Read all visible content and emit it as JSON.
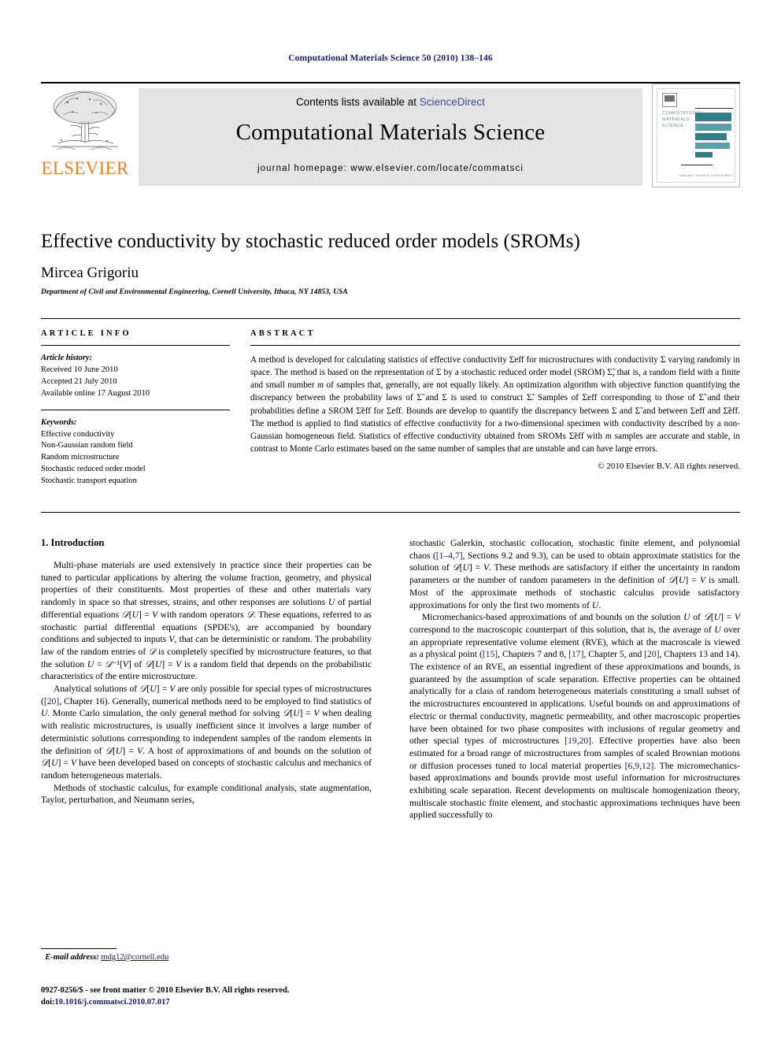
{
  "running_head": "Computational Materials Science 50 (2010) 138–146",
  "masthead": {
    "contents_prefix": "Contents lists available at ",
    "sciencedirect": "ScienceDirect",
    "journal_title": "Computational Materials Science",
    "homepage": "journal homepage: www.elsevier.com/locate/commatsci",
    "publisher": "ELSEVIER",
    "cover": {
      "line1": "COMPUTATIONAL",
      "line2": "MATERIALS",
      "line3": "SCIENCE",
      "footer": "AVAILABLE ONLINE AT SCIENCEDIRECT"
    },
    "link_color": "#3b4ba8",
    "brand_color": "#ef7d22",
    "banner_bg": "#e4e4e4"
  },
  "article": {
    "title": "Effective conductivity by stochastic reduced order models (SROMs)",
    "author": "Mircea Grigoriu",
    "affiliation": "Department of Civil and Environmental Engineering, Cornell University, Ithaca, NY 14853, USA"
  },
  "info": {
    "heading": "ARTICLE INFO",
    "history_label": "Article history:",
    "history": [
      "Received 10 June 2010",
      "Accepted 21 July 2010",
      "Available online 17 August 2010"
    ],
    "keywords_label": "Keywords:",
    "keywords": [
      "Effective conductivity",
      "Non-Gaussian random field",
      "Random microstructure",
      "Stochastic reduced order model",
      "Stochastic transport equation"
    ]
  },
  "abstract": {
    "heading": "ABSTRACT",
    "text": "A method is developed for calculating statistics of effective conductivity Σeff for microstructures with conductivity Σ varying randomly in space. The method is based on the representation of Σ by a stochastic reduced order model (SROM) Σ̃, that is, a random field with a finite and small number m of samples that, generally, are not equally likely. An optimization algorithm with objective function quantifying the discrepancy between the probability laws of Σ̃ and Σ is used to construct Σ̃. Samples of Σeff corresponding to those of Σ̃ and their probabilities define a SROM Σ̃eff for Σeff. Bounds are develop to quantify the discrepancy between Σ and Σ̃ and between Σeff and Σ̃eff. The method is applied to find statistics of effective conductivity for a two-dimensional specimen with conductivity described by a non-Gaussian homogeneous field. Statistics of effective conductivity obtained from SROMs Σ̃eff with m samples are accurate and stable, in contrast to Monte Carlo estimates based on the same number of samples that are unstable and can have large errors.",
    "copyright": "© 2010 Elsevier B.V. All rights reserved."
  },
  "body": {
    "section_heading": "1. Introduction",
    "left_paragraphs": [
      "Multi-phase materials are used extensively in practice since their properties can be tuned to particular applications by altering the volume fraction, geometry, and physical properties of their constituents. Most properties of these and other materials vary randomly in space so that stresses, strains, and other responses are solutions U of partial differential equations 𝒟[U] = V with random operators 𝒟. These equations, referred to as stochastic partial differential equations (SPDE's), are accompanied by boundary conditions and subjected to inputs V, that can be deterministic or random. The probability law of the random entries of 𝒟 is completely specified by microstructure features, so that the solution U = 𝒟⁻¹[V] of 𝒟[U] = V is a random field that depends on the probabilistic characteristics of the entire microstructure.",
      "Analytical solutions of 𝒟[U] = V are only possible for special types of microstructures ([20], Chapter 16). Generally, numerical methods need to be employed to find statistics of U. Monte Carlo simulation, the only general method for solving 𝒟[U] = V when dealing with realistic microstructures, is usually inefficient since it involves a large number of deterministic solutions corresponding to independent samples of the random elements in the definition of 𝒟[U] = V. A host of approximations of and bounds on the solution of 𝒟[U] = V have been developed based on concepts of stochastic calculus and mechanics of random heterogeneous materials.",
      "Methods of stochastic calculus, for example conditional analysis, state augmentation, Taylor, perturbation, and Neumann series,"
    ],
    "right_paragraphs": [
      "stochastic Galerkin, stochastic collocation, stochastic finite element, and polynomial chaos ([1–4,7], Sections 9.2 and 9.3), can be used to obtain approximate statistics for the solution of 𝒟[U] = V. These methods are satisfactory if either the uncertainty in random parameters or the number of random parameters in the definition of 𝒟[U] = V is small. Most of the approximate methods of stochastic calculus provide satisfactory approximations for only the first two moments of U.",
      "Micromechanics-based approximations of and bounds on the solution U of 𝒟[U] = V correspond to the macroscopic counterpart of this solution, that is, the average of U over an appropriate representative volume element (RVE), which at the macroscale is viewed as a physical point ([15], Chapters 7 and 8, [17], Chapter 5, and [20], Chapters 13 and 14). The existence of an RVE, an essential ingredient of these approximations and bounds, is guaranteed by the assumption of scale separation. Effective properties can be obtained analytically for a class of random heterogeneous materials constituting a small subset of the microstructures encountered in applications. Useful bounds on and approximations of electric or thermal conductivity, magnetic permeability, and other macroscopic properties have been obtained for two phase composites with inclusions of regular geometry and other special types of microstructures [19,20]. Effective properties have also been estimated for a broad range of microstructures from samples of scaled Brownian motions or diffusion processes tuned to local material properties [6,9,12]. The micromechanics-based approximations and bounds provide most useful information for microstructures exhibiting scale separation. Recent developments on multiscale homogenization theory, multiscale stochastic finite element, and stochastic approximations techniques have been applied successfully to"
    ]
  },
  "footer": {
    "email_label": "E-mail address:",
    "email": "mdg12@cornell.edu",
    "issn_line": "0927-0256/$ - see front matter © 2010 Elsevier B.V. All rights reserved.",
    "doi_label": "doi:",
    "doi": "10.1016/j.commatsci.2010.07.017"
  }
}
